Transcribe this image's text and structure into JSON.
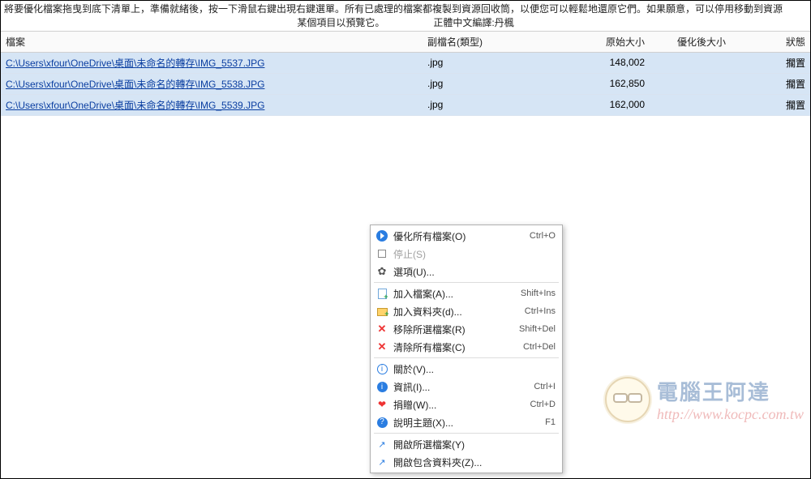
{
  "intro": {
    "line1": "將要優化檔案拖曳到底下清單上，準備就緒後，按一下滑鼠右鍵出現右鍵選單。所有已處理的檔案都複製到資源回收筒，以便您可以輕鬆地還原它們。如果願意，可以停用移動到資源",
    "line2a": "某個項目以預覽它。",
    "line2b": "正體中文編譯:丹楓"
  },
  "columns": {
    "file": "檔案",
    "ext": "副檔名(類型)",
    "orig": "原始大小",
    "opt": "優化後大小",
    "status": "狀態"
  },
  "rows": [
    {
      "path": "C:\\Users\\xfour\\OneDrive\\桌面\\未命名的轉存\\IMG_5537.JPG",
      "ext": ".jpg",
      "orig": "148,002",
      "status": "擱置"
    },
    {
      "path": "C:\\Users\\xfour\\OneDrive\\桌面\\未命名的轉存\\IMG_5538.JPG",
      "ext": ".jpg",
      "orig": "162,850",
      "status": "擱置"
    },
    {
      "path": "C:\\Users\\xfour\\OneDrive\\桌面\\未命名的轉存\\IMG_5539.JPG",
      "ext": ".jpg",
      "orig": "162,000",
      "status": "擱置"
    }
  ],
  "menu": {
    "optimize": {
      "label": "優化所有檔案(O)",
      "shortcut": "Ctrl+O"
    },
    "stop": {
      "label": "停止(S)"
    },
    "options": {
      "label": "選項(U)..."
    },
    "addFile": {
      "label": "加入檔案(A)...",
      "shortcut": "Shift+Ins"
    },
    "addFolder": {
      "label": "加入資料夾(d)...",
      "shortcut": "Ctrl+Ins"
    },
    "removeSel": {
      "label": "移除所選檔案(R)",
      "shortcut": "Shift+Del"
    },
    "clearAll": {
      "label": "清除所有檔案(C)",
      "shortcut": "Ctrl+Del"
    },
    "about": {
      "label": "關於(V)..."
    },
    "info": {
      "label": "資訊(I)...",
      "shortcut": "Ctrl+I"
    },
    "donate": {
      "label": "捐贈(W)...",
      "shortcut": "Ctrl+D"
    },
    "helpTopics": {
      "label": "說明主題(X)...",
      "shortcut": "F1"
    },
    "openSel": {
      "label": "開啟所選檔案(Y)"
    },
    "openFolder": {
      "label": "開啟包含資料夾(Z)..."
    }
  },
  "watermark": {
    "title": "電腦王阿達",
    "url": "http://www.kocpc.com.tw"
  }
}
